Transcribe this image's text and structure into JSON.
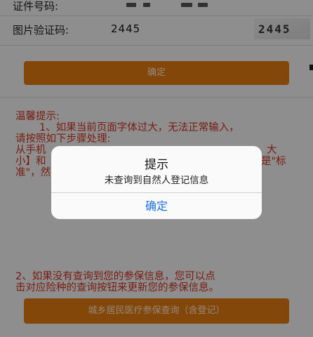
{
  "form": {
    "id_label": "证件号码:",
    "captcha_label": "图片验证码:",
    "captcha_value": "2445",
    "captcha_image_text": "2445"
  },
  "confirm_button": "确定",
  "tips": {
    "heading": "温馨提示:",
    "line1": "1、如果当前页面字体过大，无法正常输入，",
    "line2": "请按照如下步骤处理:",
    "line3": "从手机",
    "line3_end": "大",
    "line4": "小】和",
    "line4_end": "是\"标",
    "line5": "准\"，然",
    "tip2_line1": "2、如果没有查询到您的参保信息，您可以点",
    "tip2_line2": "击对应险种的查询按钮来更新您的参保信息。"
  },
  "query_button": "城乡居民医疗参保查询（含登记）",
  "dialog": {
    "title": "提示",
    "message": "未查询到自然人登记信息",
    "ok": "确定"
  },
  "colors": {
    "accent": "#e37b12",
    "tip_text": "#d0321f",
    "dialog_button": "#1a73d9"
  }
}
